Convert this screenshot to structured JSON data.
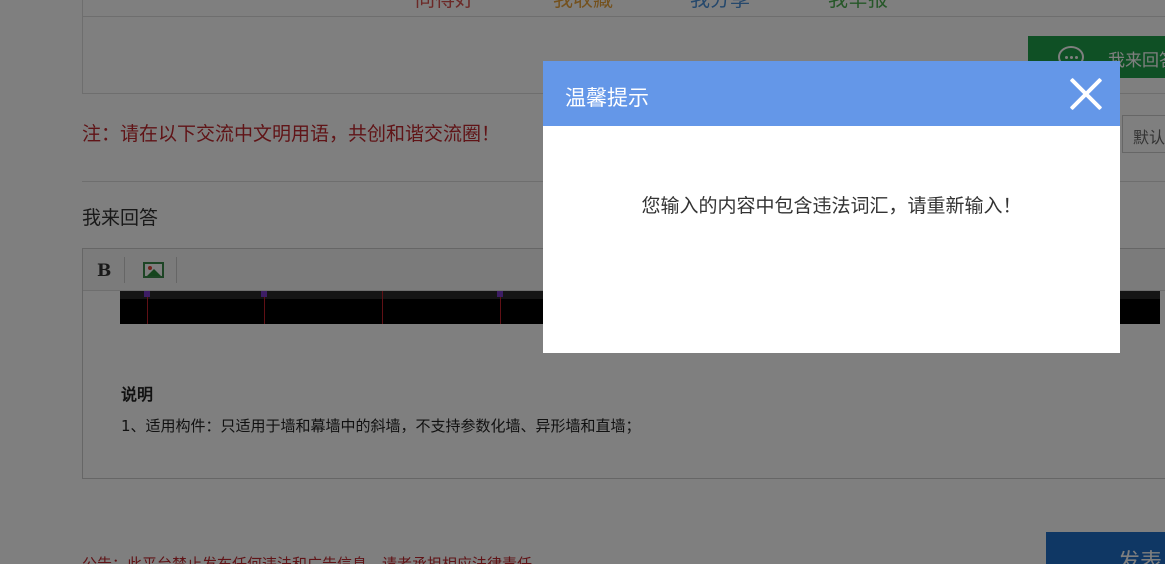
{
  "colors": {
    "dialog_header": "#6497e8",
    "notice_red": "#c0282e",
    "answer_green": "#1fa04a",
    "publish_blue": "#1e6fc8",
    "link_red": "#d9534f",
    "link_orange": "#e8a33a",
    "link_blue": "#4a90d9",
    "link_green": "#4caf50"
  },
  "actions": {
    "link1": "同得好",
    "link2": "我收藏",
    "link3": "我分享",
    "link4": "我举报",
    "answer_button": "我来回答"
  },
  "notice": "注：请在以下交流中文明用语，共创和谐交流圈！",
  "sort_select": "默认",
  "answer_section": {
    "title": "我来回答"
  },
  "editor": {
    "bold_label": "B",
    "image_icon": "image-icon",
    "desc_title": "说明",
    "desc_line": "1、适用构件：只适用于墙和幕墙中的斜墙，不支持参数化墙、异形墙和直墙；"
  },
  "footer": {
    "note": "公告：此平台禁止发布任何违法和广告信息，请者承担相应法律责任",
    "publish_button": "发表"
  },
  "dialog": {
    "title": "温馨提示",
    "message": "您输入的内容中包含违法词汇，请重新输入！",
    "close_icon": "close-icon"
  }
}
